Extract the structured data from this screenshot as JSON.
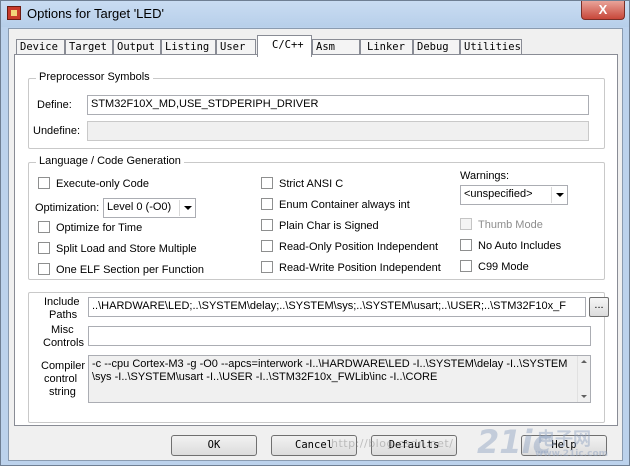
{
  "window": {
    "title": "Options for Target 'LED'",
    "close_label": "X"
  },
  "tabs": [
    {
      "label": "Device"
    },
    {
      "label": "Target"
    },
    {
      "label": "Output"
    },
    {
      "label": "Listing"
    },
    {
      "label": "User"
    },
    {
      "label": "C/C++",
      "active": true
    },
    {
      "label": "Asm"
    },
    {
      "label": "Linker"
    },
    {
      "label": "Debug"
    },
    {
      "label": "Utilities"
    }
  ],
  "preprocessor": {
    "group_label": "Preprocessor Symbols",
    "define_label": "Define:",
    "define_value": "STM32F10X_MD,USE_STDPERIPH_DRIVER",
    "undefine_label": "Undefine:",
    "undefine_value": ""
  },
  "language": {
    "group_label": "Language / Code Generation",
    "execute_only": "Execute-only Code",
    "optimization_label": "Optimization:",
    "optimization_value": "Level 0 (-O0)",
    "optimize_time": "Optimize for Time",
    "split_load": "Split Load and Store Multiple",
    "one_elf": "One ELF Section per Function",
    "strict_ansi": "Strict ANSI C",
    "enum_container": "Enum Container always int",
    "plain_char": "Plain Char is Signed",
    "ropi": "Read-Only Position Independent",
    "rwpi": "Read-Write Position Independent",
    "warnings_label": "Warnings:",
    "warnings_value": "<unspecified>",
    "thumb_mode": "Thumb Mode",
    "no_auto_includes": "No Auto Includes",
    "c99_mode": "C99 Mode"
  },
  "paths": {
    "include_label_1": "Include",
    "include_label_2": "Paths",
    "include_value": "..\\HARDWARE\\LED;..\\SYSTEM\\delay;..\\SYSTEM\\sys;..\\SYSTEM\\usart;..\\USER;..\\STM32F10x_F",
    "browse_label": "...",
    "misc_label_1": "Misc",
    "misc_label_2": "Controls",
    "misc_value": "",
    "compiler_label_1": "Compiler",
    "compiler_label_2": "control",
    "compiler_label_3": "string",
    "compiler_line_1": "-c --cpu Cortex-M3 -g -O0 --apcs=interwork -I..\\HARDWARE\\LED -I..\\SYSTEM\\delay -I..\\SYSTEM",
    "compiler_line_2": "\\sys -I..\\SYSTEM\\usart -I..\\USER -I..\\STM32F10x_FWLib\\inc -I..\\CORE"
  },
  "buttons": {
    "ok": "OK",
    "cancel": "Cancel",
    "defaults": "Defaults",
    "help": "Help"
  },
  "watermark": {
    "text": "http://blog.csdn.net/",
    "logo_big": "21ic",
    "logo_cn": "电子网",
    "logo_url": "www.21ic.com"
  }
}
